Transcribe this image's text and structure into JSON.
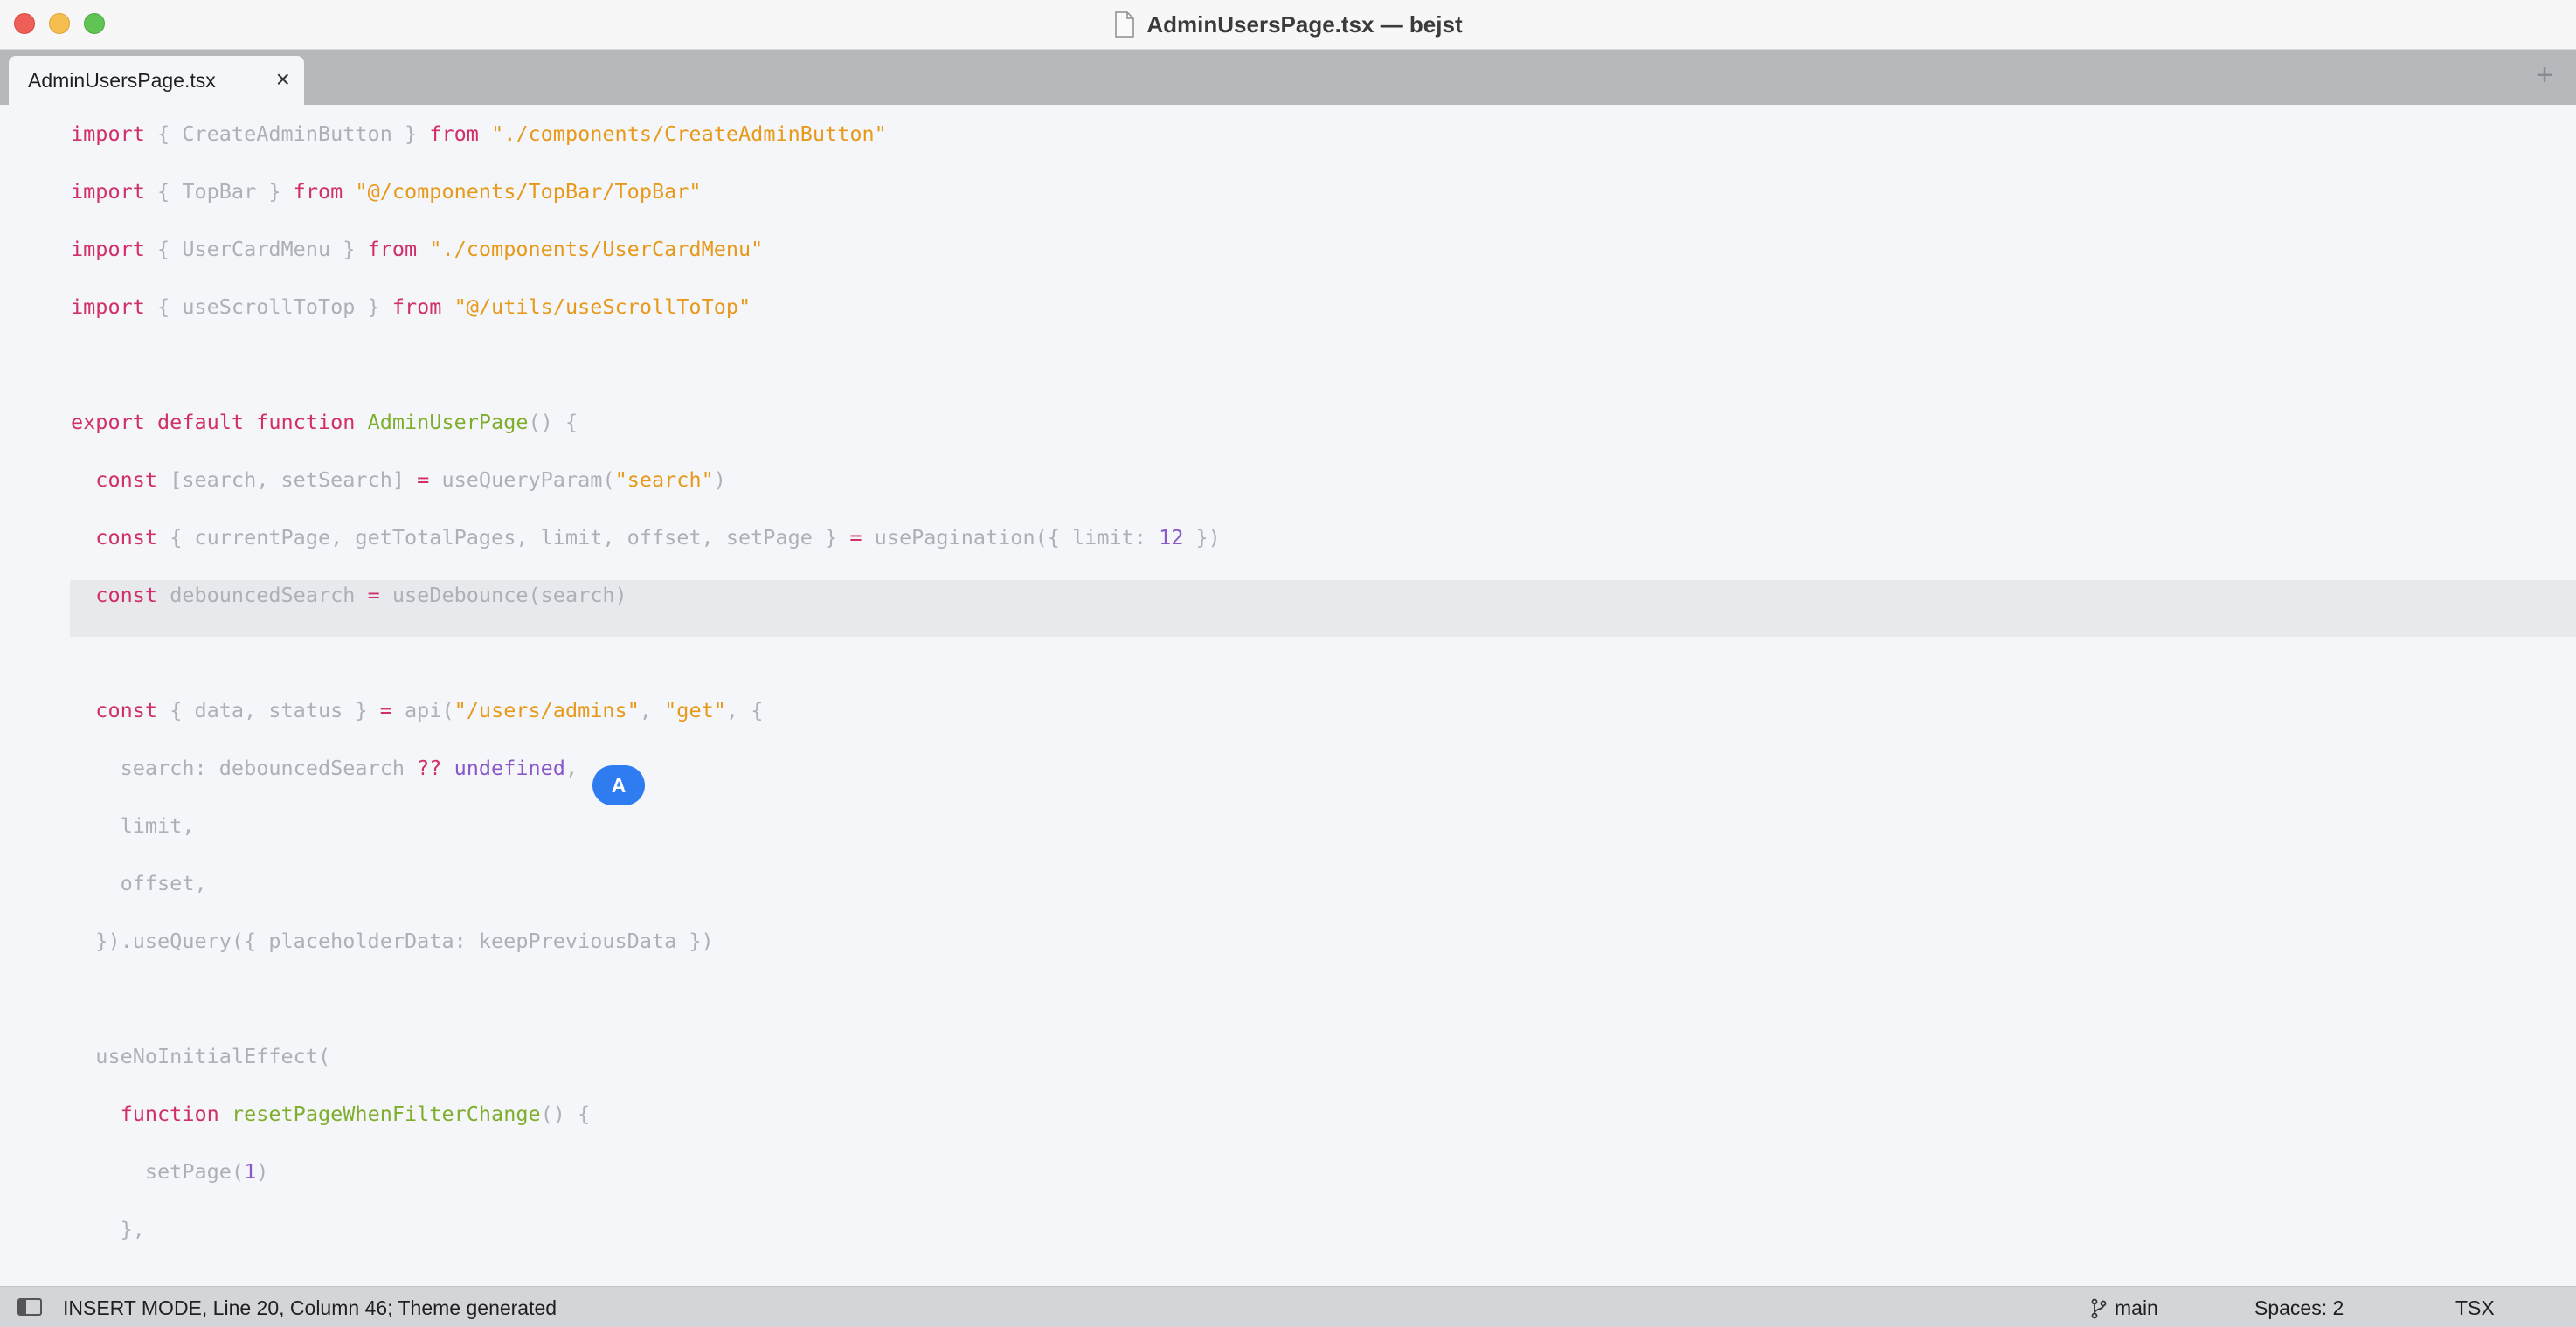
{
  "window": {
    "title": "AdminUsersPage.tsx — bejst"
  },
  "tabs": [
    {
      "label": "AdminUsersPage.tsx",
      "close": "×"
    }
  ],
  "tabbar": {
    "add": "+"
  },
  "editor": {
    "cursor_badge": "A",
    "lines": [
      [
        [
          "kw",
          "import"
        ],
        [
          "mut",
          " { CreateAdminButton } "
        ],
        [
          "kw",
          "from"
        ],
        [
          "mut",
          " "
        ],
        [
          "str",
          "\"./components/CreateAdminButton\""
        ]
      ],
      [
        [
          "kw",
          "import"
        ],
        [
          "mut",
          " { TopBar } "
        ],
        [
          "kw",
          "from"
        ],
        [
          "mut",
          " "
        ],
        [
          "str",
          "\"@/components/TopBar/TopBar\""
        ]
      ],
      [
        [
          "kw",
          "import"
        ],
        [
          "mut",
          " { UserCardMenu } "
        ],
        [
          "kw",
          "from"
        ],
        [
          "mut",
          " "
        ],
        [
          "str",
          "\"./components/UserCardMenu\""
        ]
      ],
      [
        [
          "kw",
          "import"
        ],
        [
          "mut",
          " { useScrollToTop } "
        ],
        [
          "kw",
          "from"
        ],
        [
          "mut",
          " "
        ],
        [
          "str",
          "\"@/utils/useScrollToTop\""
        ]
      ],
      [],
      [
        [
          "kw",
          "export default function"
        ],
        [
          "mut",
          " "
        ],
        [
          "fn",
          "AdminUserPage"
        ],
        [
          "mut",
          "() {"
        ]
      ],
      [
        [
          "mut",
          "  "
        ],
        [
          "kw",
          "const"
        ],
        [
          "mut",
          " [search, setSearch] "
        ],
        [
          "kw",
          "="
        ],
        [
          "mut",
          " useQueryParam("
        ],
        [
          "str",
          "\"search\""
        ],
        [
          "mut",
          ")"
        ]
      ],
      [
        [
          "mut",
          "  "
        ],
        [
          "kw",
          "const"
        ],
        [
          "mut",
          " { currentPage, getTotalPages, limit, offset, setPage } "
        ],
        [
          "kw",
          "="
        ],
        [
          "mut",
          " usePagination({ limit: "
        ],
        [
          "num",
          "12"
        ],
        [
          "mut",
          " })"
        ]
      ],
      [
        [
          "mut",
          "  "
        ],
        [
          "kw",
          "const"
        ],
        [
          "mut",
          " debouncedSearch "
        ],
        [
          "kw",
          "="
        ],
        [
          "mut",
          " useDebounce(search)"
        ]
      ],
      [],
      [
        [
          "mut",
          "  "
        ],
        [
          "kw",
          "const"
        ],
        [
          "mut",
          " { data, status } "
        ],
        [
          "kw",
          "="
        ],
        [
          "mut",
          " api("
        ],
        [
          "str",
          "\"/users/admins\""
        ],
        [
          "mut",
          ", "
        ],
        [
          "str",
          "\"get\""
        ],
        [
          "mut",
          ", {"
        ]
      ],
      [
        [
          "mut",
          "    search: debouncedSearch "
        ],
        [
          "kw",
          "??"
        ],
        [
          "mut",
          " "
        ],
        [
          "undef",
          "undefined"
        ],
        [
          "mut",
          ","
        ]
      ],
      [
        [
          "mut",
          "    limit,"
        ]
      ],
      [
        [
          "mut",
          "    offset,"
        ]
      ],
      [
        [
          "mut",
          "  }).useQuery({ placeholderData: keepPreviousData })"
        ]
      ],
      [],
      [
        [
          "mut",
          "  useNoInitialEffect("
        ]
      ],
      [
        [
          "mut",
          "    "
        ],
        [
          "kw",
          "function"
        ],
        [
          "mut",
          " "
        ],
        [
          "fn",
          "resetPageWhenFilterChange"
        ],
        [
          "mut",
          "() {"
        ]
      ],
      [
        [
          "mut",
          "      setPage("
        ],
        [
          "num",
          "1"
        ],
        [
          "mut",
          ")"
        ]
      ],
      [
        [
          "mut",
          "    },"
        ]
      ]
    ]
  },
  "statusbar": {
    "mode_text": "INSERT MODE, Line 20, Column 46; Theme generated",
    "branch": "main",
    "spaces": "Spaces: 2",
    "language": "TSX"
  }
}
